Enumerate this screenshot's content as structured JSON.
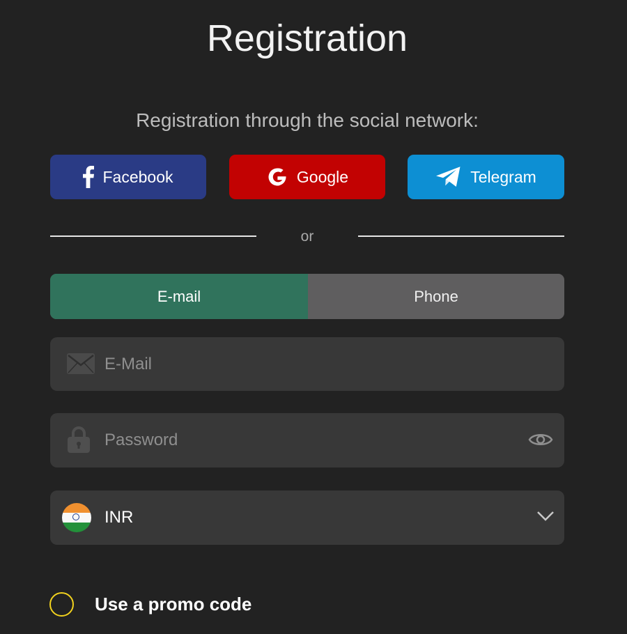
{
  "header": {
    "title": "Registration",
    "subtitle": "Registration through the social network:"
  },
  "social": {
    "facebook_label": "Facebook",
    "google_label": "Google",
    "telegram_label": "Telegram",
    "facebook_color": "#2a3b85",
    "google_color": "#c20202",
    "telegram_color": "#0d8fd3"
  },
  "divider": {
    "or_label": "or"
  },
  "tabs": [
    {
      "label": "E-mail",
      "active": true
    },
    {
      "label": "Phone",
      "active": false
    }
  ],
  "form": {
    "email": {
      "placeholder": "E-Mail",
      "value": "",
      "icon": "envelope-icon"
    },
    "password": {
      "placeholder": "Password",
      "value": "",
      "icon": "lock-icon",
      "toggle_icon": "eye-icon"
    },
    "currency": {
      "value": "INR",
      "flag": "india-flag-icon",
      "icon": "chevron-down-icon"
    }
  },
  "promo": {
    "label": "Use a promo code",
    "checked": false,
    "accent": "#f2d21e"
  },
  "colors": {
    "background": "#222222",
    "field": "#383838",
    "active_tab": "#30735c",
    "inactive_tab": "#5f5e5f"
  }
}
